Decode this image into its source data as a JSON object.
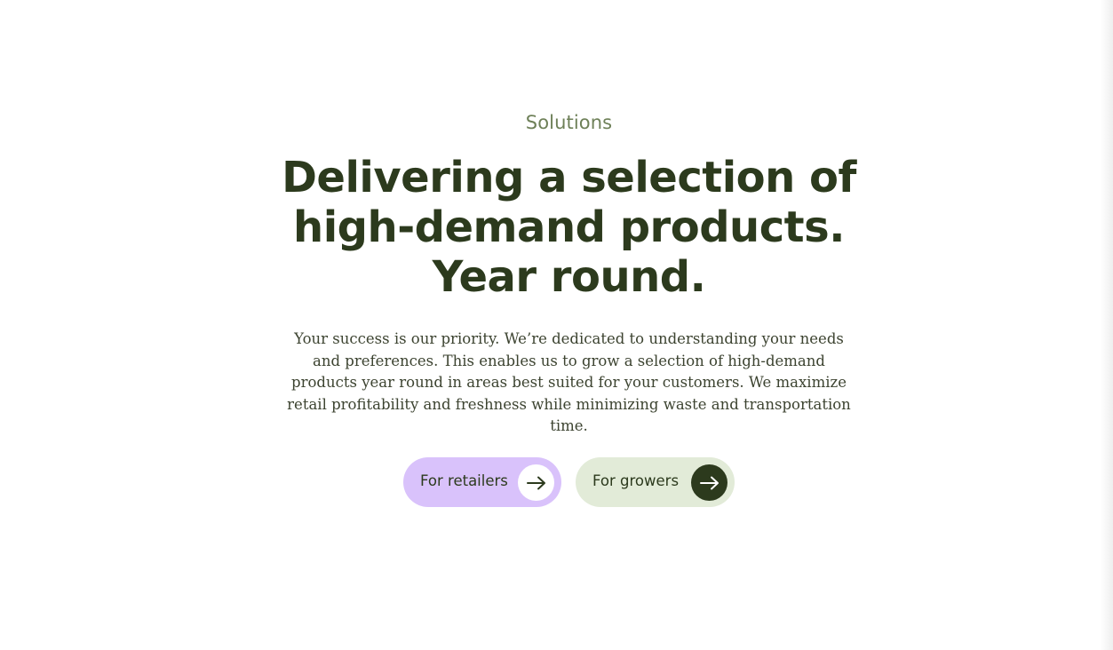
{
  "solutions": {
    "eyebrow": "Solutions",
    "headline_line1": "Delivering a selection of",
    "headline_line2": "high-demand products.",
    "headline_line3": "Year round.",
    "body": "Your success is our priority. We’re dedicated to understanding your needs and preferences. This enables us to grow a selection of high-demand products year round in areas best suited for your customers. We maximize retail profitability and freshness while minimizing waste and transportation time.",
    "buttons": [
      {
        "label": "For retailers",
        "icon": "arrow-right-icon"
      },
      {
        "label": "For growers",
        "icon": "arrow-right-icon"
      }
    ]
  },
  "colors": {
    "background": "#ffffff",
    "eyebrow": "#6e8058",
    "heading": "#2c3a1d",
    "body_text": "#3c4330",
    "retailers_button_bg": "#d9c2fb",
    "growers_button_bg": "#e2ebd8",
    "dark_circle": "#2c3a1d"
  }
}
